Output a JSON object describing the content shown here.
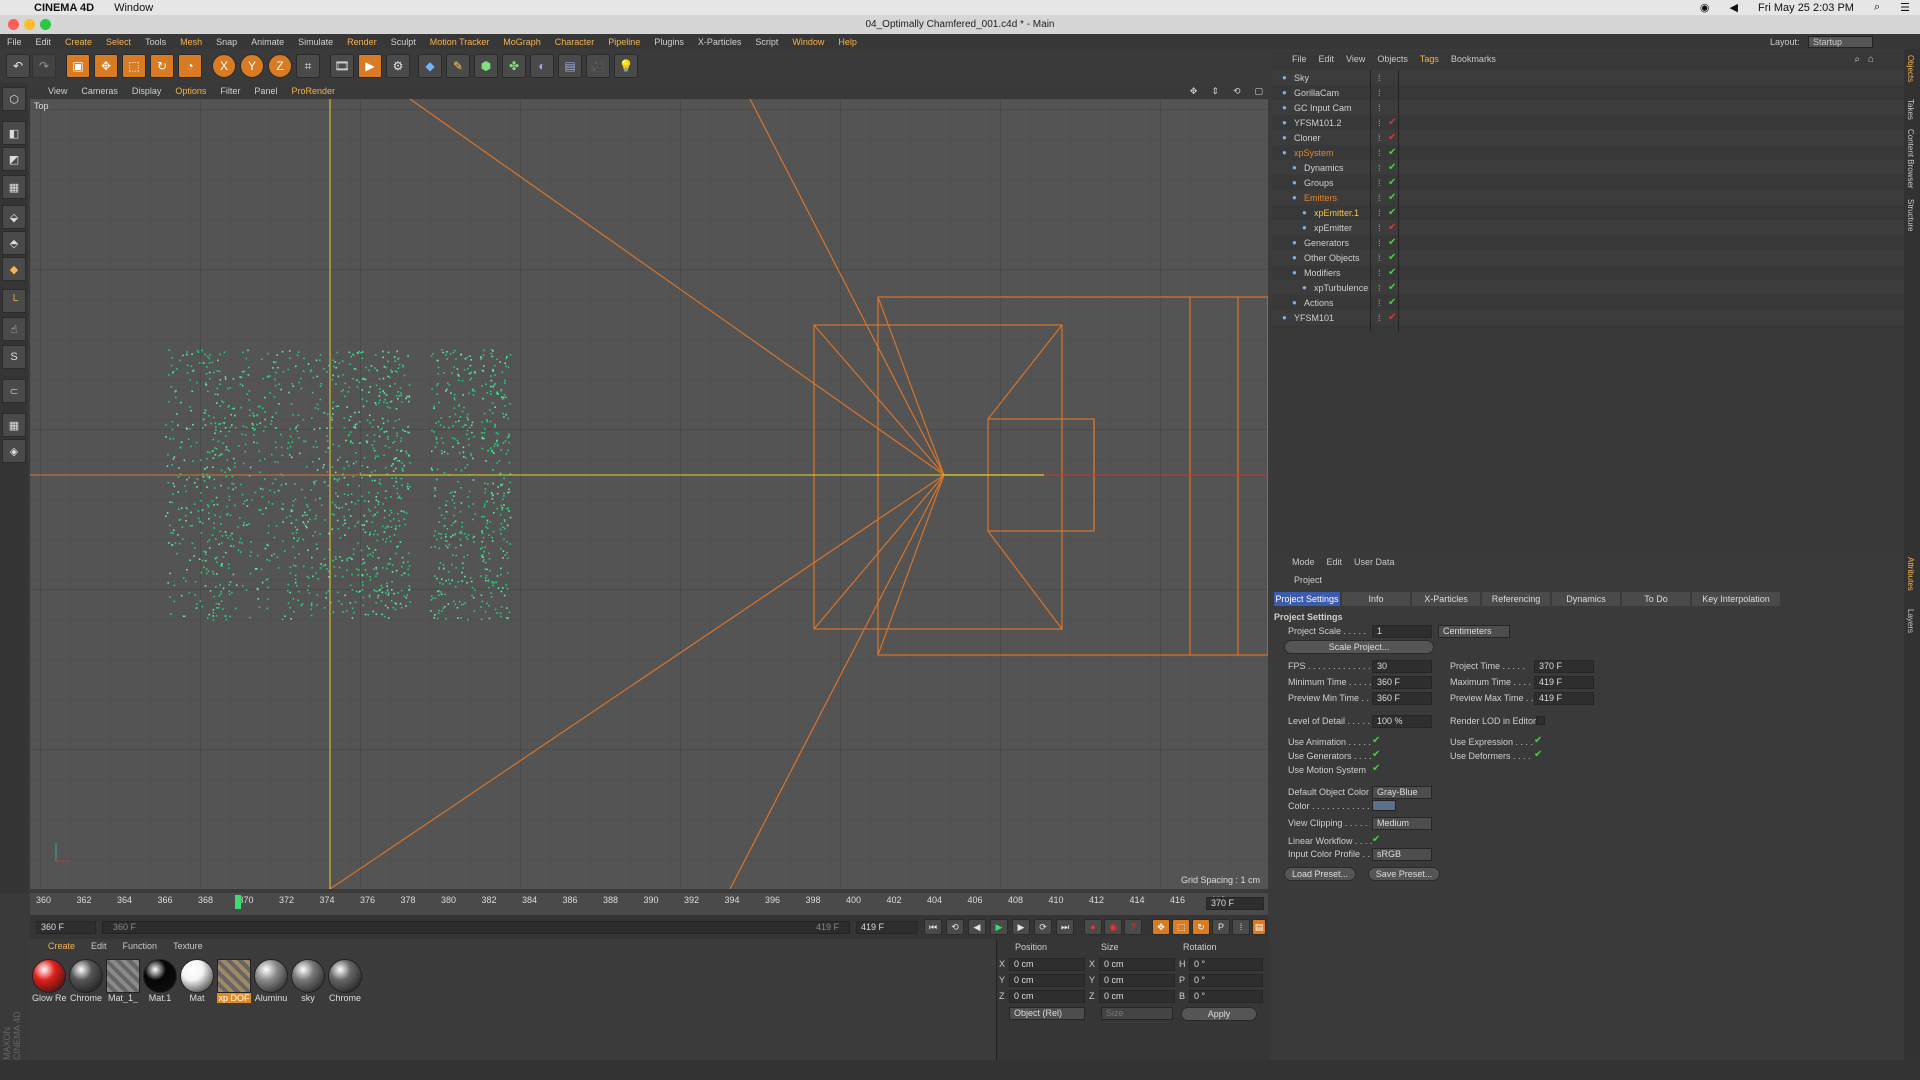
{
  "mac_menu": {
    "app": "CINEMA 4D",
    "window": "Window",
    "clock": "Fri May 25  2:03 PM"
  },
  "window_title": "04_Optimally Chamfered_001.c4d * - Main",
  "menubar": [
    "File",
    "Edit",
    "Create",
    "Select",
    "Tools",
    "Mesh",
    "Snap",
    "Animate",
    "Simulate",
    "Render",
    "Sculpt",
    "Motion Tracker",
    "MoGraph",
    "Character",
    "Pipeline",
    "Plugins",
    "X-Particles",
    "Script",
    "Window",
    "Help"
  ],
  "toolbar_axes": [
    "X",
    "Y",
    "Z"
  ],
  "viewport": {
    "menu": [
      "View",
      "Cameras",
      "Display",
      "Options",
      "Filter",
      "Panel",
      "ProRender"
    ],
    "label": "Top",
    "grid_spacing": "Grid Spacing : 1 cm"
  },
  "timeline": {
    "ticks": [
      "360",
      "362",
      "364",
      "366",
      "368",
      "370",
      "372",
      "374",
      "376",
      "378",
      "380",
      "382",
      "384",
      "386",
      "388",
      "390",
      "392",
      "394",
      "396",
      "398",
      "400",
      "402",
      "404",
      "406",
      "408",
      "410",
      "412",
      "414",
      "416",
      "418"
    ],
    "current_frame": "370 F",
    "start_field": "360 F",
    "range_start": "360 F",
    "range_end": "419 F",
    "end_field": "419 F"
  },
  "material_manager": {
    "menu": [
      "Create",
      "Edit",
      "Function",
      "Texture"
    ],
    "materials": [
      {
        "name": "Glow Re",
        "color": "#e0201a"
      },
      {
        "name": "Chrome",
        "color": "#555555"
      },
      {
        "name": "Mat_1_",
        "color": "#8a8a8a"
      },
      {
        "name": "Mat.1",
        "color": "#050505"
      },
      {
        "name": "Mat",
        "color": "#f4f4f4"
      },
      {
        "name": "xp DOF",
        "color": "#a08a66"
      },
      {
        "name": "Aluminu",
        "color": "#8c8c8c"
      },
      {
        "name": "sky",
        "color": "#777777"
      },
      {
        "name": "Chrome",
        "color": "#666666"
      }
    ]
  },
  "coord_manager": {
    "headers": [
      "Position",
      "Size",
      "Rotation"
    ],
    "rows": [
      {
        "axis": "X",
        "pos": "0 cm",
        "size_axis": "X",
        "size": "0 cm",
        "rot_axis": "H",
        "rot": "0 °"
      },
      {
        "axis": "Y",
        "pos": "0 cm",
        "size_axis": "Y",
        "size": "0 cm",
        "rot_axis": "P",
        "rot": "0 °"
      },
      {
        "axis": "Z",
        "pos": "0 cm",
        "size_axis": "Z",
        "size": "0 cm",
        "rot_axis": "B",
        "rot": "0 °"
      }
    ],
    "mode": "Object (Rel)",
    "size_mode": "Size",
    "apply": "Apply"
  },
  "object_manager": {
    "menu": [
      "File",
      "Edit",
      "View",
      "Objects",
      "Tags",
      "Bookmarks"
    ],
    "objects": [
      {
        "name": "Sky",
        "indent": 0,
        "color": "#cfcfcf"
      },
      {
        "name": "GorillaCam",
        "indent": 0,
        "color": "#cfcfcf"
      },
      {
        "name": "GC Input Cam",
        "indent": 0,
        "color": "#cfcfcf"
      },
      {
        "name": "YFSM101.2",
        "indent": 0,
        "color": "#cfcfcf"
      },
      {
        "name": "Cloner",
        "indent": 0,
        "color": "#cfcfcf"
      },
      {
        "name": "xpSystem",
        "indent": 0,
        "color": "#e0862e"
      },
      {
        "name": "Dynamics",
        "indent": 1,
        "color": "#cfcfcf"
      },
      {
        "name": "Groups",
        "indent": 1,
        "color": "#cfcfcf"
      },
      {
        "name": "Emitters",
        "indent": 1,
        "color": "#e0862e"
      },
      {
        "name": "xpEmitter.1",
        "indent": 2,
        "color": "#f7c44d"
      },
      {
        "name": "xpEmitter",
        "indent": 2,
        "color": "#cfcfcf"
      },
      {
        "name": "Generators",
        "indent": 1,
        "color": "#cfcfcf"
      },
      {
        "name": "Other Objects",
        "indent": 1,
        "color": "#cfcfcf"
      },
      {
        "name": "Modifiers",
        "indent": 1,
        "color": "#cfcfcf"
      },
      {
        "name": "xpTurbulence",
        "indent": 2,
        "color": "#cfcfcf"
      },
      {
        "name": "Actions",
        "indent": 1,
        "color": "#cfcfcf"
      },
      {
        "name": "YFSM101",
        "indent": 0,
        "color": "#cfcfcf"
      }
    ]
  },
  "attribute_manager": {
    "menu": [
      "Mode",
      "Edit",
      "User Data"
    ],
    "object": "Project",
    "tabs": [
      "Project Settings",
      "Info",
      "X-Particles",
      "Referencing",
      "Dynamics",
      "To Do",
      "Key Interpolation"
    ],
    "section": "Project Settings",
    "project_scale_label": "Project Scale . . . . .",
    "project_scale": "1",
    "scale_unit": "Centimeters",
    "scale_project_btn": "Scale Project...",
    "fields_left": [
      {
        "label": "FPS . . . . . . . . . . . . .",
        "value": "30"
      },
      {
        "label": "Minimum Time . . . . .",
        "value": "360 F"
      },
      {
        "label": "Preview Min Time . .",
        "value": "360 F"
      }
    ],
    "fields_right": [
      {
        "label": "Project Time . . . . .",
        "value": "370 F"
      },
      {
        "label": "Maximum Time . . . .",
        "value": "419 F"
      },
      {
        "label": "Preview Max Time . .",
        "value": "419 F"
      }
    ],
    "lod_label": "Level of Detail . . . . .",
    "lod": "100 %",
    "render_lod_label": "Render LOD in Editor",
    "checks_left": [
      "Use Animation . . . . .",
      "Use Generators . . . .",
      "Use Motion System"
    ],
    "checks_right": [
      "Use Expression . . . .",
      "Use Deformers . . . ."
    ],
    "default_color_label": "Default Object Color",
    "default_color": "Gray-Blue",
    "color_label": "Color . . . . . . . . . . . .",
    "view_clipping_label": "View Clipping . . . . .",
    "view_clipping": "Medium",
    "linear_workflow_label": "Linear Workflow . . . .",
    "input_color_label": "Input Color Profile . .",
    "input_color": "sRGB",
    "load_preset": "Load Preset...",
    "save_preset": "Save Preset..."
  },
  "layout": {
    "label": "Layout:",
    "value": "Startup"
  },
  "right_tabs": [
    "Objects",
    "Takes",
    "Content Browser",
    "Structure",
    "Attributes",
    "Layers"
  ],
  "branding": "MAXON CINEMA 4D"
}
